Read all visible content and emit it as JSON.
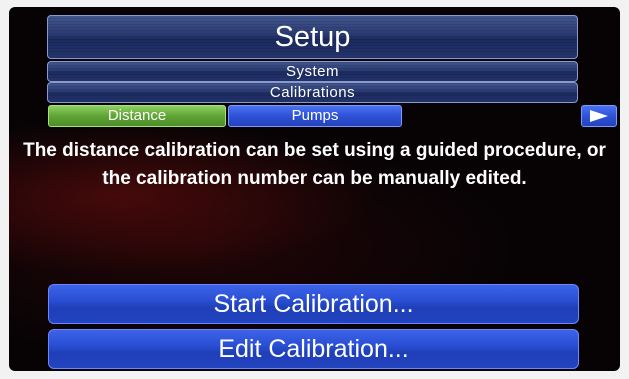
{
  "header": {
    "title": "Setup",
    "breadcrumb": [
      "System",
      "Calibrations"
    ]
  },
  "tabs": [
    {
      "label": "Distance",
      "active": true
    },
    {
      "label": "Pumps",
      "active": false
    }
  ],
  "next_tab_icon": "right-arrow-icon",
  "description": "The distance calibration can be set using a guided procedure, or the calibration number can be manually edited.",
  "actions": {
    "start_label": "Start Calibration...",
    "edit_label": "Edit Calibration..."
  },
  "colors": {
    "active_tab": "#5fa436",
    "inactive_tab": "#2e52d8",
    "header_bar": "#2a3a72",
    "screen_bg": "#070305"
  }
}
